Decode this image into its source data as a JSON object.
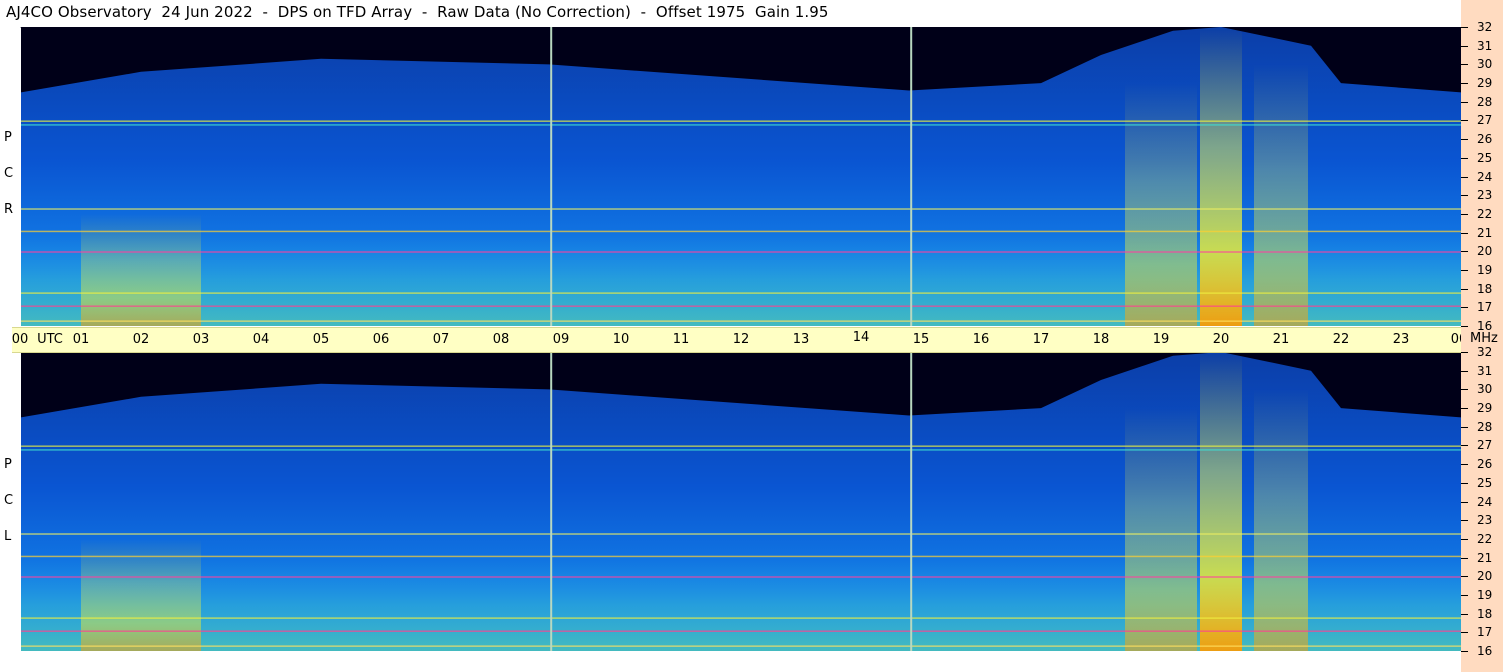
{
  "title": "AJ4CO Observatory  24 Jun 2022  -  DPS on TFD Array  -  Raw Data (No Correction)  -  Offset 1975  Gain 1.95",
  "panels": [
    {
      "label_chars": [
        "P",
        "C",
        "R"
      ]
    },
    {
      "label_chars": [
        "P",
        "C",
        "L"
      ]
    }
  ],
  "time_axis": {
    "ticks": [
      "00",
      "01",
      "02",
      "03",
      "04",
      "05",
      "06",
      "07",
      "08",
      "09",
      "10",
      "11",
      "12",
      "13",
      "14",
      "15",
      "16",
      "17",
      "18",
      "19",
      "20",
      "21",
      "22",
      "23",
      "00"
    ],
    "utc_label": "UTC"
  },
  "freq_axis": {
    "unit": "MHz",
    "ticks": [
      "32",
      "31",
      "30",
      "29",
      "28",
      "27",
      "26",
      "25",
      "24",
      "23",
      "22",
      "21",
      "20",
      "19",
      "18",
      "17",
      "16"
    ]
  },
  "colors": {
    "time_axis_bg": "#ffffc4",
    "freq_axis_bg": "#ffdbc0",
    "spectrogram_low": "#000020",
    "spectrogram_mid": "#0a5ad8",
    "spectrogram_high": "#ffe000",
    "spectrogram_peak": "#ff4000"
  },
  "chart_data": {
    "type": "heatmap",
    "title": "AJ4CO Observatory  24 Jun 2022  -  DPS on TFD Array  -  Raw Data (No Correction)  -  Offset 1975  Gain 1.95",
    "xlabel": "UTC",
    "ylabel": "MHz",
    "x_range_hours": [
      0,
      24
    ],
    "y_range_mhz": [
      16,
      32
    ],
    "series": [
      {
        "name": "RCP"
      },
      {
        "name": "LCP"
      }
    ],
    "gap_markers_hours": [
      8.82,
      14.82
    ],
    "noise_boundary_mhz_by_hour": [
      [
        0,
        28.5
      ],
      [
        2,
        29.6
      ],
      [
        5,
        30.3
      ],
      [
        8.8,
        30.0
      ],
      [
        14.8,
        28.6
      ],
      [
        17,
        29.0
      ],
      [
        18,
        30.5
      ],
      [
        19.2,
        31.8
      ],
      [
        20,
        32.0
      ],
      [
        21.5,
        31.0
      ],
      [
        22,
        29.0
      ],
      [
        24,
        28.5
      ]
    ],
    "bright_bands_hours": [
      {
        "center": 20.0,
        "width": 0.7,
        "top_mhz": 32
      },
      {
        "center": 19.0,
        "width": 1.2,
        "top_mhz": 29
      },
      {
        "center": 21.0,
        "width": 0.9,
        "top_mhz": 30
      },
      {
        "center": 2.0,
        "width": 2.0,
        "top_mhz": 22
      }
    ],
    "rfi_lines_mhz": [
      27.0,
      26.8,
      22.3,
      21.1,
      20.0,
      17.8,
      17.1,
      16.3
    ],
    "grid": false
  }
}
